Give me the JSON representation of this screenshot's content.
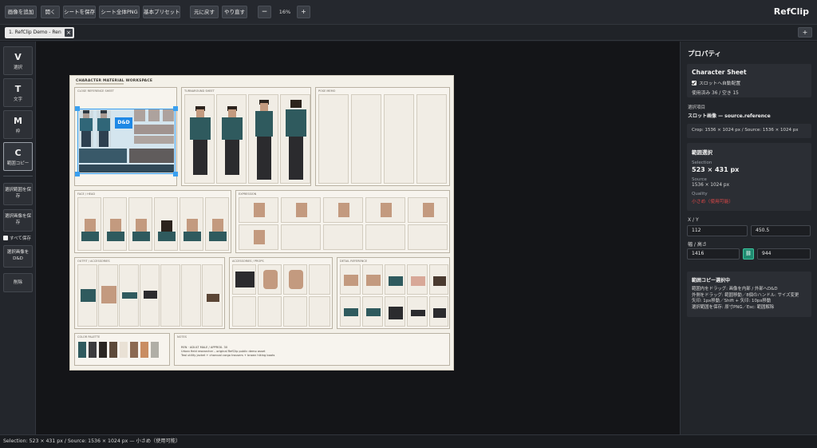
{
  "toolbar": {
    "add_image": "画像を追加",
    "open": "開く",
    "save_sheet": "シートを保存",
    "sheet_png": "シート全体PNG",
    "basic_preset": "基本プリセット",
    "undo": "元に戻す",
    "redo": "やり直す",
    "zoom_out": "−",
    "zoom_level": "16%",
    "zoom_in": "+"
  },
  "app": {
    "brand": "RefClip"
  },
  "tabs": [
    {
      "label": "1. RefClip Demo - Ren",
      "close": "×"
    }
  ],
  "tab_add": "+",
  "tools": [
    {
      "key": "V",
      "label": "選択"
    },
    {
      "key": "T",
      "label": "文字"
    },
    {
      "key": "M",
      "label": "枠"
    },
    {
      "key": "C",
      "label": "範囲コピー"
    }
  ],
  "actions": {
    "save_selection": "選択範囲を保存",
    "save_image": "選択画像を保存",
    "save_all": "すべて保存",
    "selection_dnd": "選択画像をD&D",
    "delete": "削除"
  },
  "canvas": {
    "sheet_title": "CHARACTER MATERIAL WORKSPACE",
    "dnd_badge": "D&D",
    "panels": {
      "p1": "CLOSE REFERENCE SHEET",
      "p2": "TURNAROUND SHEET",
      "p3": "POSE MEMO",
      "p4": "FACE / HEAD",
      "p5": "EXPRESSION",
      "p6": "OUTFIT / ACCESSORIES",
      "p7": "ACCESSORIES / PROPS",
      "p8": "DETAIL REFERENCE",
      "p9": "COLOR PALETTE",
      "p10": "NOTES"
    },
    "notes": [
      "REN · ADULT MALE / APPROX. 30",
      "Urban field researcher – original RefClip public demo asset",
      "Teal utility jacket + charcoal cargo trousers + brown hiking boots"
    ],
    "palette": [
      "#2f5a5e",
      "#3b3b3e",
      "#2a2623",
      "#5d4a3b",
      "#e9e1d5",
      "#8c6a52",
      "#c98d63",
      "#b0aea6"
    ]
  },
  "properties": {
    "title": "プロパティ",
    "card_title": "Character Sheet",
    "auto_place": "スロットへ自動配置",
    "usage": "使用済み 36 / 空き 15",
    "selected_label": "選択項目",
    "selected_value": "スロット画像 — source.reference",
    "crop_info": "Crop: 1536 × 1024 px / Source: 1536 × 1024 px",
    "range_title": "範囲選択",
    "selection_label": "Selection",
    "selection_value": "523 × 431 px",
    "source_label": "Source",
    "source_value": "1536 × 1024 px",
    "quality_label": "Quality",
    "quality_value": "小さめ（使用可能）",
    "xy_label": "X / Y",
    "x": "112",
    "y": "450.5",
    "wh_label": "幅 / 高さ",
    "w": "1416",
    "h": "944",
    "link_icon": "⛓",
    "help_title": "範囲コピー選択中",
    "help_lines": [
      "範囲内をドラッグ: 画像を内部 / 外部へD&D",
      "外側をドラッグ: 範囲移動／8個のハンドル: サイズ変更",
      "矢印: 1px移動／Shift + 矢印: 10px移動",
      "選択範囲を保存: 原寸PNG／Esc: 範囲解除"
    ]
  },
  "status": "Selection: 523 × 431 px / Source: 1536 × 1024 px — 小さめ（使用可能）",
  "colors": {
    "accent": "#1e88e5",
    "selection": "#3aa0f0",
    "link": "#1f8a70",
    "warning": "#e04848"
  }
}
